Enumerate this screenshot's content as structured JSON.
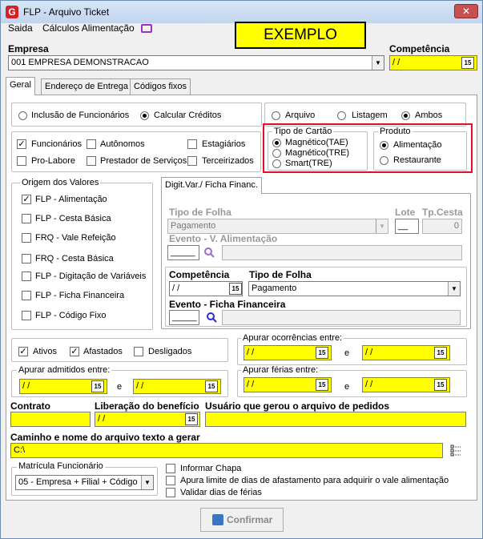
{
  "window": {
    "title": "FLP - Arquivo Ticket",
    "close": "✕"
  },
  "menu": {
    "item1": "Saida",
    "item2": "Cálculos Alimentação"
  },
  "banner": "EXEMPLO",
  "empresa": {
    "label": "Empresa",
    "value": "001 EMPRESA DEMONSTRACAO"
  },
  "competencia": {
    "label": "Competência",
    "value": " / /"
  },
  "tabs": [
    "Geral",
    "Endereço de Entrega",
    "Códigos fixos"
  ],
  "mode": {
    "opt1": "Inclusão de Funcionários",
    "opt2": "Calcular Créditos",
    "selected": "Calcular Créditos"
  },
  "output": {
    "opt1": "Arquivo",
    "opt2": "Listagem",
    "opt3": "Ambos",
    "selected": "Ambos"
  },
  "tipo_cartao": {
    "title": "Tipo de Cartão",
    "opt1": "Magnético(TAE)",
    "opt2": "Magnético(TRE)",
    "opt3": "Smart(TRE)",
    "selected": "Magnético(TAE)"
  },
  "produto": {
    "title": "Produto",
    "opt1": "Alimentação",
    "opt2": "Restaurante",
    "selected": "Alimentação"
  },
  "categorias": {
    "c1": "Funcionários",
    "c2": "Autônomos",
    "c3": "Estagiários",
    "c4": "Pro-Labore",
    "c5": "Prestador de Serviços",
    "c6": "Terceirizados",
    "checked": [
      "Funcionários"
    ]
  },
  "origem": {
    "title": "Origem dos Valores",
    "o1": "FLP - Alimentação",
    "o2": "FLP - Cesta Básica",
    "o3": "FRQ - Vale Refeição",
    "o4": "FRQ - Cesta Básica",
    "o5": "FLP - Digitação de Variáveis",
    "o6": "FLP - Ficha Financeira",
    "o7": "FLP - Código Fixo",
    "checked": [
      "FLP - Alimentação"
    ]
  },
  "digvar": {
    "tab": "Digit.Var./ Ficha Financ.",
    "tipo_label": "Tipo de Folha",
    "tipo_value": "Pagamento",
    "lote_label": "Lote",
    "lote_value": "__",
    "tpcesta_label": "Tp.Cesta",
    "tpcesta_value": "0",
    "evento_label": "Evento - V. Alimentação",
    "evento_value": "_____"
  },
  "ficha": {
    "comp_label": "Competência",
    "comp_value": " / /",
    "tipo_label": "Tipo de Folha",
    "tipo_value": "Pagamento",
    "evento_label": "Evento - Ficha Financeira",
    "evento_value": "_____"
  },
  "situacao": {
    "s1": "Ativos",
    "s2": "Afastados",
    "s3": "Desligados",
    "checked": [
      "Ativos",
      "Afastados"
    ]
  },
  "ocorrencias": {
    "title": "Apurar ocorrências entre:",
    "from": " / /",
    "sep": "e",
    "to": " / /"
  },
  "admitidos": {
    "title": "Apurar admitidos entre:",
    "from": " / /",
    "sep": "e",
    "to": " / /"
  },
  "ferias": {
    "title": "Apurar férias entre:",
    "from": " / /",
    "sep": "e",
    "to": " / /"
  },
  "contrato": {
    "label": "Contrato",
    "value": ""
  },
  "liberacao": {
    "label": "Liberação do benefício",
    "value": " / /"
  },
  "usuario": {
    "label": "Usuário que gerou o arquivo de pedidos",
    "value": ""
  },
  "caminho": {
    "label": "Caminho e nome do arquivo texto a gerar",
    "value": "C:\\"
  },
  "matricula": {
    "title": "Matrícula Funcionário",
    "value": "05 - Empresa + Filial + Código"
  },
  "opcoes": {
    "o1": "Informar Chapa",
    "o2": "Apura limite de dias de afastamento para adquirir o vale alimentação",
    "o3": "Validar dias de férias"
  },
  "calendar_glyph": "15",
  "confirm": "Confirmar"
}
